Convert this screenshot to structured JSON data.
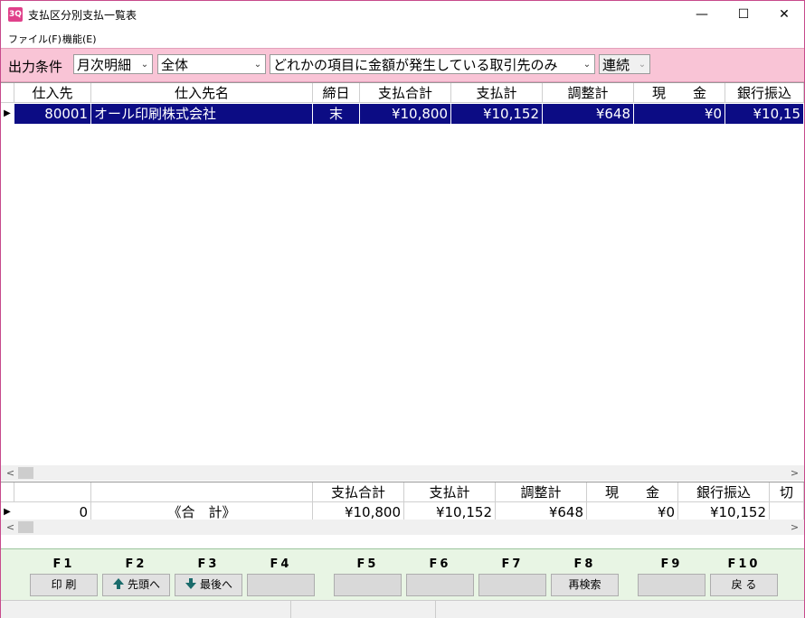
{
  "window": {
    "title": "支払区分別支払一覧表",
    "app_icon_text": "3Q",
    "controls": [
      "—",
      "☐",
      "✕"
    ]
  },
  "menu": [
    {
      "label": "ファイル(F)"
    },
    {
      "label": "機能(E)"
    }
  ],
  "conditions": {
    "label": "出力条件",
    "period": "月次明細",
    "scope": "全体",
    "filter": "どれかの項目に金額が発生している取引先のみ",
    "mode": "連続"
  },
  "grid": {
    "columns": [
      "仕入先",
      "仕入先名",
      "締日",
      "支払合計",
      "支払計",
      "調整計",
      "現　　金",
      "銀行振込"
    ],
    "rows": [
      {
        "code": "80001",
        "name": "オール印刷株式会社",
        "closing": "末",
        "pay_total": "¥10,800",
        "pay_sum": "¥10,152",
        "adjust": "¥648",
        "cash": "¥0",
        "bank": "¥10,15"
      }
    ]
  },
  "totals": {
    "columns": [
      "支払合計",
      "支払計",
      "調整計",
      "現　　金",
      "銀行振込",
      "切"
    ],
    "row": {
      "count": "0",
      "label": "《合　計》",
      "pay_total": "¥10,800",
      "pay_sum": "¥10,152",
      "adjust": "¥648",
      "cash": "¥0",
      "bank": "¥10,152"
    }
  },
  "fkeys": [
    {
      "key": "F1",
      "label": "印 刷"
    },
    {
      "key": "F2",
      "label": "先頭へ",
      "icon": "arrow-up-icon"
    },
    {
      "key": "F3",
      "label": "最後へ",
      "icon": "arrow-down-icon"
    },
    {
      "key": "F4",
      "label": ""
    },
    {
      "key": "F5",
      "label": ""
    },
    {
      "key": "F6",
      "label": ""
    },
    {
      "key": "F7",
      "label": ""
    },
    {
      "key": "F8",
      "label": "再検索"
    },
    {
      "key": "F9",
      "label": ""
    },
    {
      "key": "F10",
      "label": "戻 る"
    }
  ],
  "colors": {
    "condition_bar": "#f9c4d6",
    "selected_row": "#0c0c84",
    "fkey_bar": "#e8f5e4",
    "window_border": "#c74a8c"
  }
}
